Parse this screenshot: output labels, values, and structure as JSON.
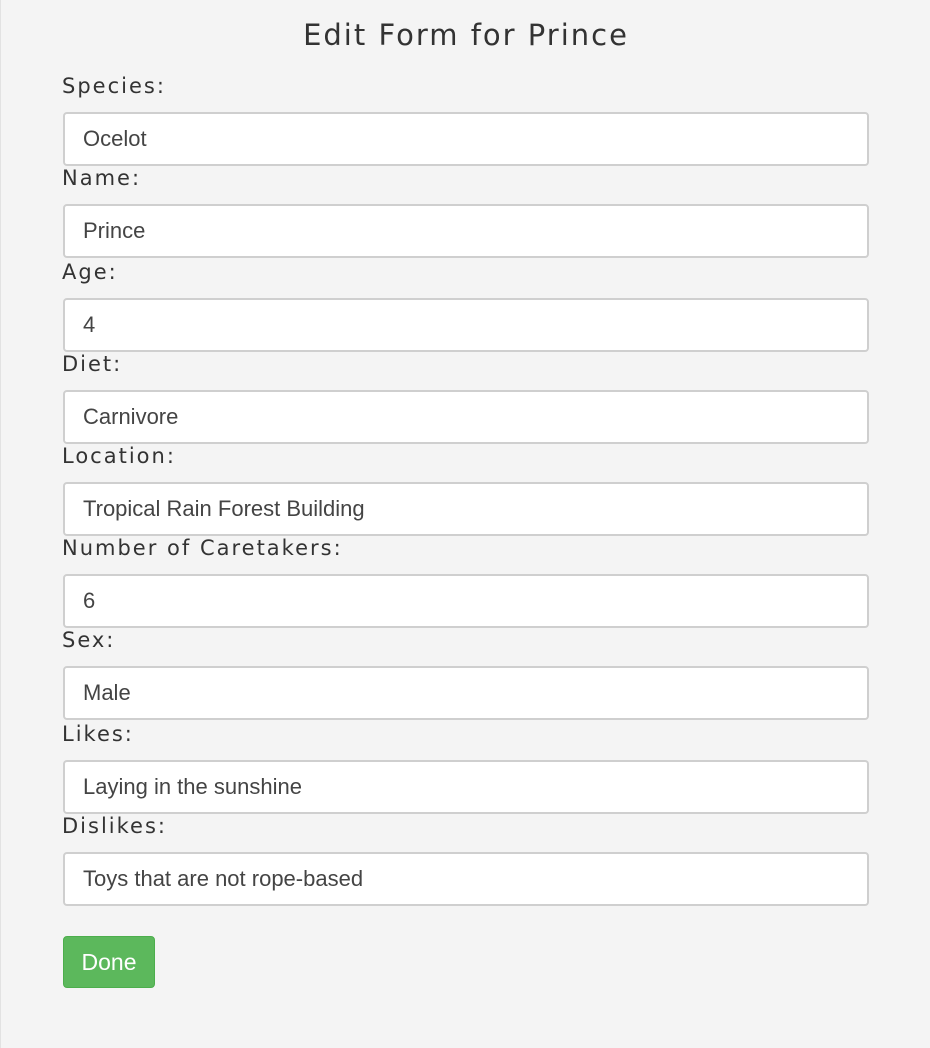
{
  "title": "Edit Form for Prince",
  "fields": [
    {
      "label": "Species:",
      "value": "Ocelot"
    },
    {
      "label": "Name:",
      "value": "Prince"
    },
    {
      "label": "Age:",
      "value": "4"
    },
    {
      "label": "Diet:",
      "value": "Carnivore"
    },
    {
      "label": "Location:",
      "value": "Tropical Rain Forest Building"
    },
    {
      "label": "Number of Caretakers:",
      "value": "6"
    },
    {
      "label": "Sex:",
      "value": "Male"
    },
    {
      "label": "Likes:",
      "value": "Laying in the sunshine"
    },
    {
      "label": "Dislikes:",
      "value": "Toys that are not rope-based"
    }
  ],
  "done_label": "Done",
  "colors": {
    "background": "#f4f4f4",
    "done_button": "#5cb85c",
    "input_border": "#cfcfcf"
  }
}
